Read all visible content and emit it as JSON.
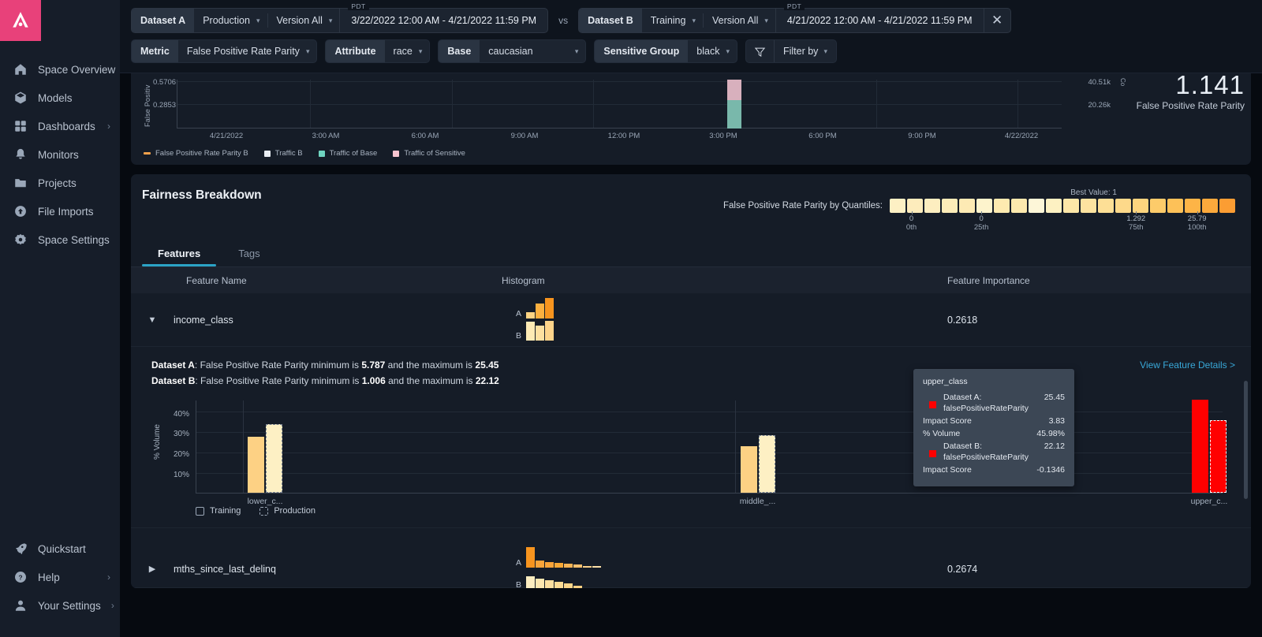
{
  "sidebar": {
    "logo_icon": "arize-logo-icon",
    "top_items": [
      {
        "label": "Space Overview",
        "icon": "home-icon",
        "chevron": false
      },
      {
        "label": "Models",
        "icon": "cube-icon",
        "chevron": false
      },
      {
        "label": "Dashboards",
        "icon": "grid-icon",
        "chevron": true
      },
      {
        "label": "Monitors",
        "icon": "bell-icon",
        "chevron": false
      },
      {
        "label": "Projects",
        "icon": "folder-icon",
        "chevron": false
      },
      {
        "label": "File Imports",
        "icon": "cloud-upload-icon",
        "chevron": false
      },
      {
        "label": "Space Settings",
        "icon": "gear-icon",
        "chevron": false
      }
    ],
    "bottom_items": [
      {
        "label": "Quickstart",
        "icon": "rocket-icon",
        "chevron": false
      },
      {
        "label": "Help",
        "icon": "question-circle-icon",
        "chevron": true
      },
      {
        "label": "Your Settings",
        "icon": "user-icon",
        "chevron": true
      }
    ],
    "chevron_glyph": "›"
  },
  "toolbar": {
    "dataset_a_label": "Dataset A",
    "dataset_a_env": "Production",
    "dataset_a_version": "Version All",
    "dataset_a_timezone": "PDT",
    "dataset_a_range": "3/22/2022 12:00 AM - 4/21/2022 11:59 PM",
    "vs": "vs",
    "dataset_b_label": "Dataset B",
    "dataset_b_env": "Training",
    "dataset_b_version": "Version All",
    "dataset_b_timezone": "PDT",
    "dataset_b_range": "4/21/2022 12:00 AM - 4/21/2022 11:59 PM",
    "close_glyph": "✕",
    "metric_label": "Metric",
    "metric_value": "False Positive Rate Parity",
    "attribute_label": "Attribute",
    "attribute_value": "race",
    "base_label": "Base",
    "base_value": "caucasian",
    "sensitive_label": "Sensitive Group",
    "sensitive_value": "black",
    "filter_label": "Filter by",
    "caret_glyph": "⌄"
  },
  "timeseries": {
    "y_axis_label": "False Positiv",
    "y_ticks": [
      "0.5706",
      "0.2853"
    ],
    "x_ticks": [
      "4/21/2022",
      "3:00 AM",
      "6:00 AM",
      "9:00 AM",
      "12:00 PM",
      "3:00 PM",
      "6:00 PM",
      "9:00 PM",
      "4/22/2022"
    ],
    "right_ticks": [
      "40.51k",
      "20.26k"
    ],
    "right_axis_label": "Co",
    "big_value": "1.141",
    "big_value_label": "False Positive Rate Parity",
    "legend": [
      {
        "label": "False Positive Rate Parity B",
        "color": "#f0a04b",
        "shape": "bar"
      },
      {
        "label": "Traffic B",
        "color": "#e8ecf2",
        "shape": "square"
      },
      {
        "label": "Traffic of Base",
        "color": "#6fd4c0",
        "shape": "square"
      },
      {
        "label": "Traffic of Sensitive",
        "color": "#f7c4cf",
        "shape": "square"
      }
    ]
  },
  "fairness": {
    "title": "Fairness Breakdown",
    "best_value_text": "Best Value: 1",
    "quantiles_label": "False Positive Rate Parity by Quantiles:",
    "quantile_colors": [
      "#fdf0c4",
      "#fdecbc",
      "#fdeec0",
      "#fdecb8",
      "#fdeab4",
      "#fdf3cc",
      "#fdeab0",
      "#fde9ae",
      "#fdf6d8",
      "#fdf1c2",
      "#fde7a8",
      "#fde3a0",
      "#fddf96",
      "#fdd98a",
      "#fdd47e",
      "#fdcb6a",
      "#fdc158",
      "#fdb447",
      "#fca93c",
      "#fb9d33"
    ],
    "quantile_ticks": [
      {
        "value": "0",
        "label": "0th",
        "pos": 3
      },
      {
        "value": "0",
        "label": "25th",
        "pos": 23
      },
      {
        "value": "1.292",
        "label": "75th",
        "pos": 68
      },
      {
        "value": "25.79",
        "label": "100th",
        "pos": 86
      }
    ],
    "tabs": [
      {
        "label": "Features",
        "active": true
      },
      {
        "label": "Tags",
        "active": false
      }
    ],
    "columns": [
      "Feature Name",
      "Histogram",
      "Feature Importance"
    ],
    "rows": [
      {
        "name": "income_class",
        "importance": "0.2618",
        "expanded": true,
        "caret": "▼",
        "hist_a": [
          30,
          70,
          100
        ],
        "hist_b": [
          90,
          70,
          95
        ],
        "hist_a_colors": [
          "#fcd383",
          "#fbb040",
          "#f7941e"
        ],
        "hist_b_colors": [
          "#fdeab4",
          "#fde0a0",
          "#fdd48a"
        ]
      },
      {
        "name": "mths_since_last_delinq",
        "importance": "0.2674",
        "expanded": false,
        "caret": "▶",
        "hist_a": [
          100,
          34,
          26,
          22,
          18,
          12,
          3,
          3
        ],
        "hist_b": [
          62,
          52,
          46,
          38,
          30,
          18,
          4
        ],
        "hist_a_colors": [
          "#f7941e",
          "#f9a43a",
          "#f9a43a",
          "#f8a836",
          "#f9b455",
          "#fac06e",
          "#fbd089",
          "#fde0a8"
        ],
        "hist_b_colors": [
          "#fdedc0",
          "#fde7b0",
          "#fde0a0",
          "#fddc95",
          "#fdd68a",
          "#fdd082",
          "#fdca78"
        ]
      }
    ],
    "detail": {
      "line_a_prefix": "Dataset A",
      "line_a_text": ": False Positive Rate Parity minimum is ",
      "line_a_min": "5.787",
      "line_a_mid": " and the maximum is ",
      "line_a_max": "25.45",
      "line_b_prefix": "Dataset B",
      "line_b_text": ": False Positive Rate Parity minimum is ",
      "line_b_min": "1.006",
      "line_b_mid": " and the maximum is ",
      "line_b_max": "22.12",
      "view_link": "View Feature Details >"
    }
  },
  "chart_data": {
    "type": "bar",
    "title": "",
    "ylabel": "% Volume",
    "xlabel": "",
    "ylim": [
      0,
      45
    ],
    "y_ticks": [
      "10%",
      "20%",
      "30%",
      "40%"
    ],
    "y_tick_values": [
      10,
      20,
      30,
      40
    ],
    "categories": [
      "lower_c...",
      "middle_...",
      "upper_c..."
    ],
    "series": [
      {
        "name": "Training",
        "values": [
          27.0,
          22.5,
          45.0
        ],
        "color": "#fdd184"
      },
      {
        "name": "Production",
        "values": [
          33.0,
          27.8,
          35.0
        ],
        "color": "#fdf0c4"
      }
    ],
    "highlight_category": "upper_c...",
    "highlight_color": "#ff0000",
    "legend": [
      {
        "label": "Training",
        "style": "solid-outline"
      },
      {
        "label": "Production",
        "style": "dashed-outline"
      }
    ]
  },
  "tooltip": {
    "title": "upper_class",
    "rows": [
      {
        "key": "Dataset A:",
        "key2": "falsePositiveRateParity",
        "value": "25.45",
        "swatch": "#ff0000",
        "indent": true
      },
      {
        "key": "Impact Score",
        "value": "3.83",
        "indent": false
      },
      {
        "key": "% Volume",
        "value": "45.98%",
        "indent": false
      },
      {
        "key": "Dataset B:",
        "key2": "falsePositiveRateParity",
        "value": "22.12",
        "swatch": "#ff0000",
        "indent": true
      },
      {
        "key": "Impact Score",
        "value": "-0.1346",
        "indent": false
      }
    ]
  }
}
